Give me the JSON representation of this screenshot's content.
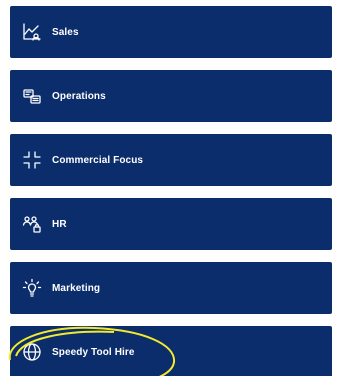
{
  "menu": {
    "items": [
      {
        "label": "Sales",
        "icon": "sales-chart-icon"
      },
      {
        "label": "Operations",
        "icon": "operations-icon"
      },
      {
        "label": "Commercial Focus",
        "icon": "focus-icon"
      },
      {
        "label": "HR",
        "icon": "people-icon"
      },
      {
        "label": "Marketing",
        "icon": "lightbulb-icon"
      },
      {
        "label": "Speedy Tool Hire",
        "icon": "globe-icon"
      }
    ]
  },
  "colors": {
    "tile_background": "#0b2d6b",
    "tile_text": "#ffffff",
    "highlight": "#f2ea2a"
  }
}
